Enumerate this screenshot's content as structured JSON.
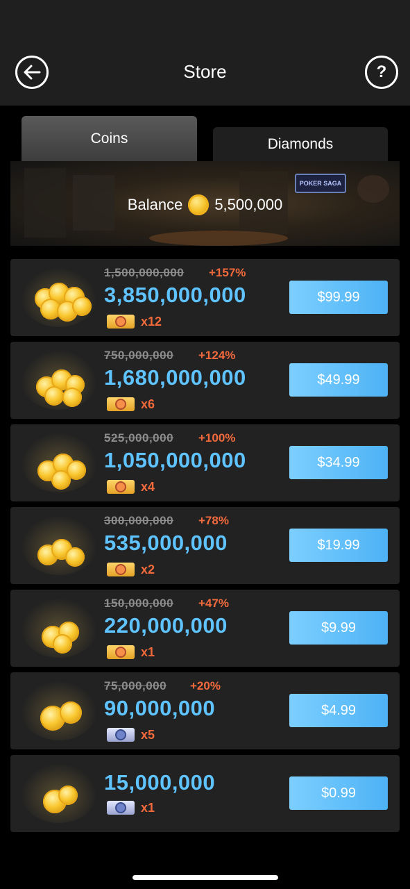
{
  "header": {
    "title": "Store",
    "back_icon": "arrow-left-icon",
    "help_label": "?"
  },
  "tabs": [
    {
      "label": "Coins",
      "active": true
    },
    {
      "label": "Diamonds",
      "active": false
    }
  ],
  "banner": {
    "sign_text": "POKER SAGA",
    "balance_label": "Balance",
    "balance_value": "5,500,000"
  },
  "packs": [
    {
      "old_amount": "1,500,000,000",
      "bonus": "+157%",
      "amount": "3,850,000,000",
      "ticket_type": "gold",
      "ticket_count": "x12",
      "price": "$99.99"
    },
    {
      "old_amount": "750,000,000",
      "bonus": "+124%",
      "amount": "1,680,000,000",
      "ticket_type": "gold",
      "ticket_count": "x6",
      "price": "$49.99"
    },
    {
      "old_amount": "525,000,000",
      "bonus": "+100%",
      "amount": "1,050,000,000",
      "ticket_type": "gold",
      "ticket_count": "x4",
      "price": "$34.99"
    },
    {
      "old_amount": "300,000,000",
      "bonus": "+78%",
      "amount": "535,000,000",
      "ticket_type": "gold",
      "ticket_count": "x2",
      "price": "$19.99"
    },
    {
      "old_amount": "150,000,000",
      "bonus": "+47%",
      "amount": "220,000,000",
      "ticket_type": "gold",
      "ticket_count": "x1",
      "price": "$9.99"
    },
    {
      "old_amount": "75,000,000",
      "bonus": "+20%",
      "amount": "90,000,000",
      "ticket_type": "silver",
      "ticket_count": "x5",
      "price": "$4.99"
    },
    {
      "old_amount": "",
      "bonus": "",
      "amount": "15,000,000",
      "ticket_type": "silver",
      "ticket_count": "x1",
      "price": "$0.99"
    }
  ],
  "colors": {
    "accent_blue": "#5fc3ff",
    "bonus_orange": "#f26a3c",
    "button_blue": "#4db2f5"
  }
}
